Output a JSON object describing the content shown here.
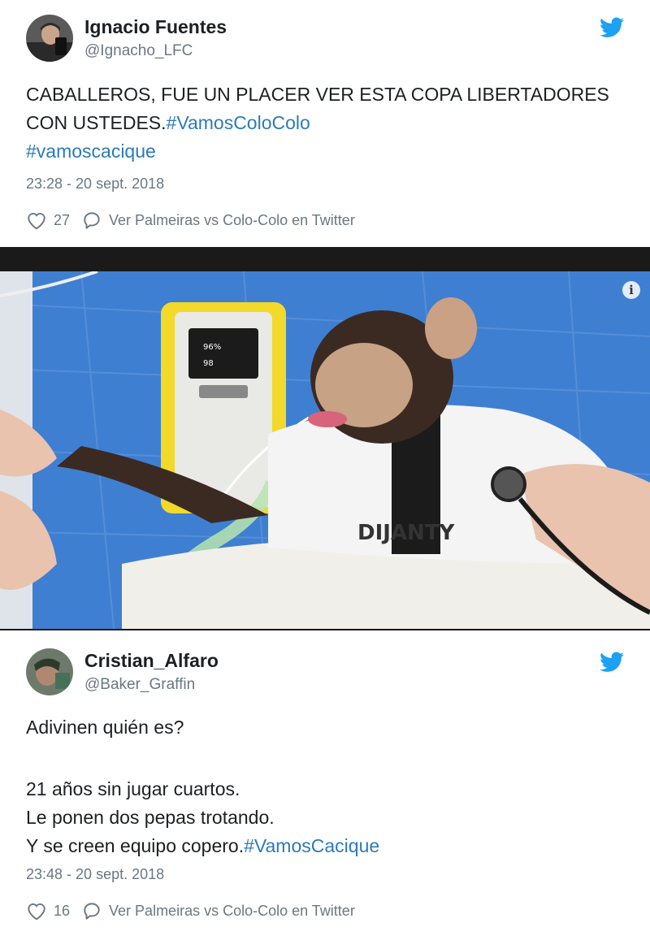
{
  "tweets": [
    {
      "author_name": "Ignacio Fuentes",
      "handle": "@Ignacho_LFC",
      "text_plain": "CABALLEROS, FUE UN PLACER VER ESTA COPA LIBERTADORES CON USTEDES.",
      "hashtag_1": "#VamosColoColo",
      "hashtag_2": "#vamoscacique",
      "timestamp": "23:28 - 20 sept. 2018",
      "likes": "27",
      "reply_label": "Ver Palmeiras vs Colo-Colo en Twitter"
    },
    {
      "author_name": "Cristian_Alfaro",
      "handle": "@Baker_Graffin",
      "line_1": "Adivinen quién es?",
      "line_2": "21 años sin jugar cuartos.",
      "line_3": "Le ponen dos pepas trotando.",
      "line_4": "Y se creen equipo copero.",
      "hashtag_1": "#VamosCacique",
      "timestamp": "23:48 - 20 sept. 2018",
      "likes": "16",
      "reply_label": "Ver Palmeiras vs Colo-Colo en Twitter"
    }
  ],
  "photo": {
    "info_glyph": "i",
    "monitor_line_1": "96%",
    "monitor_line_2": "98",
    "jersey_text": "DIJANTY"
  },
  "colors": {
    "twitter_blue": "#1da1f2",
    "hashtag": "#2b7bb9",
    "meta_gray": "#697882",
    "blanket_blue": "#3f7fd1",
    "monitor_yellow": "#f2d92a"
  },
  "icons": [
    "twitter-bird-icon",
    "heart-icon",
    "reply-bubble-icon",
    "info-icon"
  ]
}
